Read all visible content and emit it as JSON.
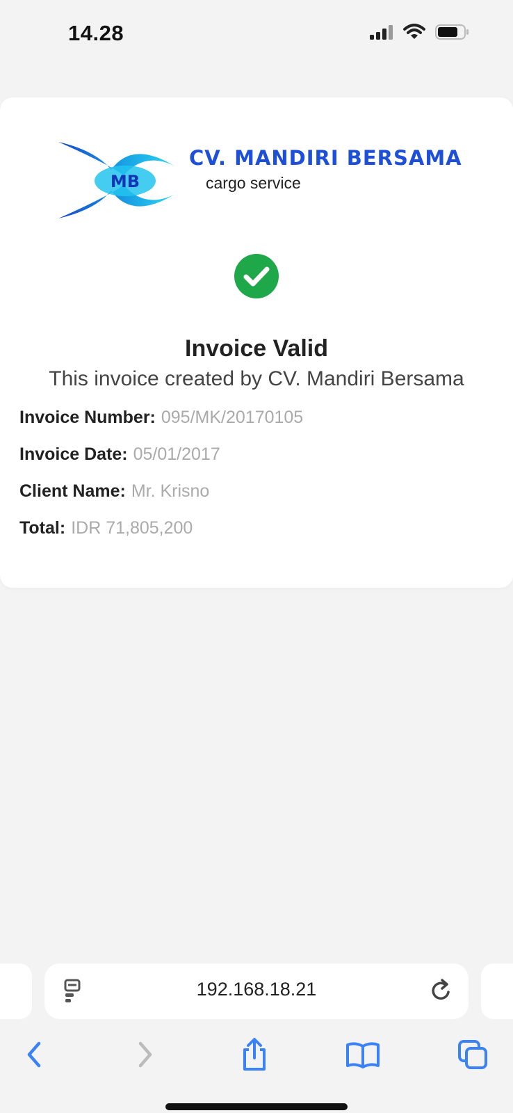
{
  "status_bar": {
    "time": "14.28",
    "icons": [
      "signal-icon",
      "wifi-icon",
      "battery-icon"
    ]
  },
  "logo": {
    "title": "CV. MANDIRI BERSAMA",
    "subtitle": "cargo service",
    "monogram": "MB"
  },
  "verification": {
    "status_icon": "check-circle-icon",
    "title": "Invoice Valid",
    "subtitle": "This invoice created by CV. Mandiri Bersama"
  },
  "details": [
    {
      "label": "Invoice Number:",
      "value": "095/MK/20170105"
    },
    {
      "label": "Invoice Date:",
      "value": "05/01/2017"
    },
    {
      "label": "Client Name:",
      "value": "Mr. Krisno"
    },
    {
      "label": "Total:",
      "value": "IDR 71,805,200"
    }
  ],
  "browser": {
    "url": "192.168.18.21",
    "site_icon": "site-settings-icon",
    "reload_icon": "reload-icon",
    "toolbar": [
      "back-icon",
      "forward-icon",
      "share-icon",
      "bookmarks-icon",
      "tabs-icon"
    ]
  },
  "colors": {
    "accent_blue": "#1d4fd8",
    "success_green": "#1fa84a",
    "toolbar_blue": "#3b82f6"
  }
}
